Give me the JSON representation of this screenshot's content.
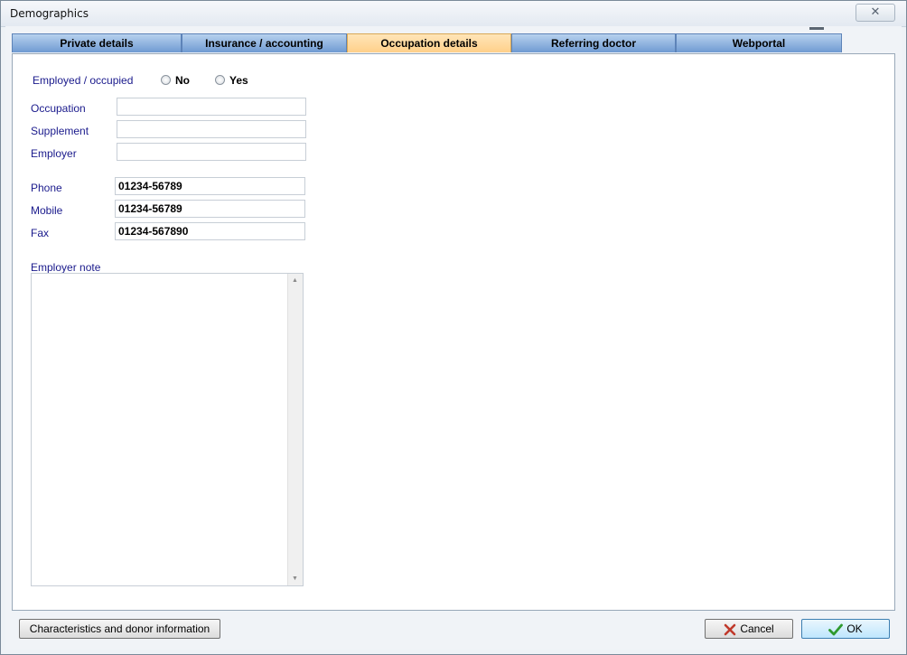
{
  "window": {
    "title": "Demographics",
    "close_glyph": "✕"
  },
  "tabs": [
    {
      "label": "Private details",
      "active": false
    },
    {
      "label": "Insurance / accounting",
      "active": false
    },
    {
      "label": "Occupation details",
      "active": true
    },
    {
      "label": "Referring doctor",
      "active": false
    },
    {
      "label": "Webportal",
      "active": false
    }
  ],
  "employment": {
    "label": "Employed / occupied",
    "option_no": "No",
    "option_yes": "Yes",
    "selected": null
  },
  "fields": {
    "occupation": {
      "label": "Occupation",
      "value": ""
    },
    "supplement": {
      "label": "Supplement",
      "value": ""
    },
    "employer": {
      "label": "Employer",
      "value": ""
    },
    "phone": {
      "label": "Phone",
      "value": "01234-56789"
    },
    "mobile": {
      "label": "Mobile",
      "value": "01234-56789"
    },
    "fax": {
      "label": "Fax",
      "value": "01234-567890"
    }
  },
  "employer_note": {
    "label": "Employer note",
    "value": ""
  },
  "buttons": {
    "characteristics": "Characteristics and donor information",
    "cancel": "Cancel",
    "ok": "OK"
  },
  "colors": {
    "label_text": "#1a1a8c",
    "tab_active": "#ffd08a",
    "tab_inactive": "#8fb3e0",
    "cancel_icon": "#c0392b",
    "ok_icon": "#2e9a2e"
  },
  "icons": {
    "close": "close-icon",
    "cancel": "x-mark-icon",
    "ok": "check-mark-icon"
  }
}
